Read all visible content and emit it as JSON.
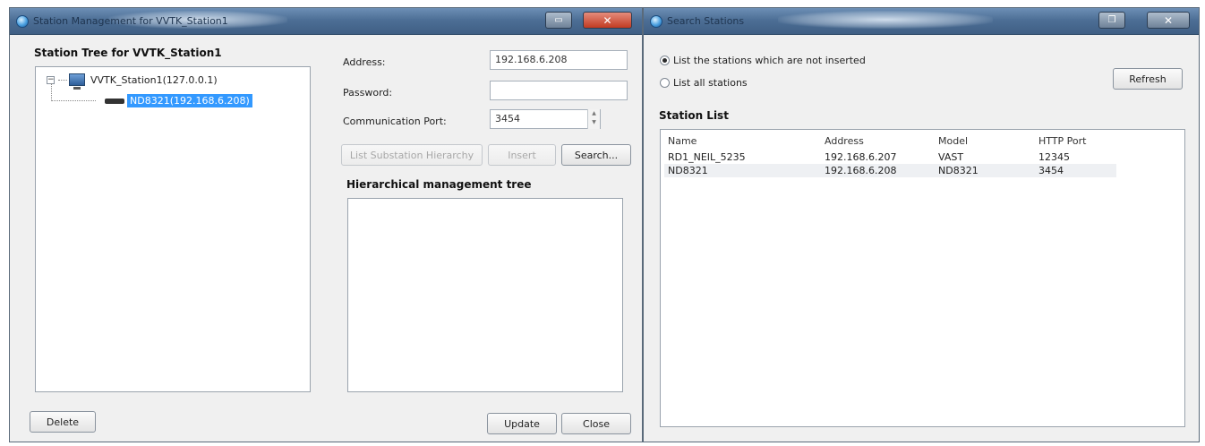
{
  "left_window": {
    "title": "Station Management for VVTK_Station1",
    "titlebar_button": "▭",
    "tree_heading": "Station Tree for VVTK_Station1",
    "tree": {
      "root_label": "VVTK_Station1(127.0.0.1)",
      "child_label": "ND8321(192.168.6.208)"
    },
    "address_label": "Address:",
    "address_value": "192.168.6.208",
    "password_label": "Password:",
    "password_value": "",
    "port_label": "Communication Port:",
    "port_value": "3454",
    "list_substation_button": "List Substation Hierarchy",
    "insert_button": "Insert",
    "search_button": "Search...",
    "hier_heading": "Hierarchical management tree",
    "delete_button": "Delete",
    "update_button": "Update",
    "close_button": "Close"
  },
  "right_window": {
    "title": "Search Stations",
    "radio_not_inserted": "List the stations which are not inserted",
    "radio_all": "List all stations",
    "refresh_button": "Refresh",
    "station_list_heading": "Station List",
    "columns": [
      "Name",
      "Address",
      "Model",
      "HTTP Port"
    ],
    "rows": [
      [
        "RD1_NEIL_5235",
        "192.168.6.207",
        "VAST",
        "12345"
      ],
      [
        "ND8321",
        "192.168.6.208",
        "ND8321",
        "3454"
      ]
    ]
  }
}
